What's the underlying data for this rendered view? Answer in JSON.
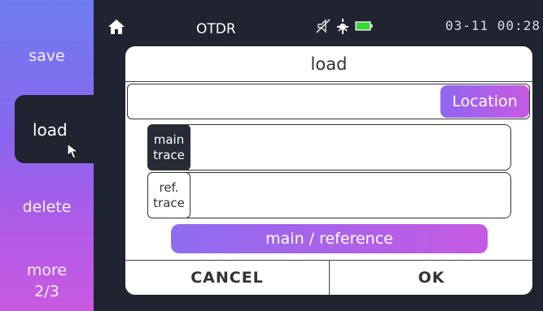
{
  "sidebar": {
    "items": [
      {
        "label": "save"
      },
      {
        "label": "load"
      },
      {
        "label": "delete"
      },
      {
        "label_line1": "more",
        "label_line2": "2/3"
      }
    ]
  },
  "statusbar": {
    "title": "OTDR",
    "datetime": "03-11 00:28",
    "icons": [
      "home-icon",
      "mute-icon",
      "sun-icon",
      "battery-icon"
    ]
  },
  "dialog": {
    "title": "load",
    "location_label": "Location",
    "main_trace": {
      "line1": "main",
      "line2": "trace"
    },
    "ref_trace": {
      "line1": "ref.",
      "line2": "trace"
    },
    "mode_label": "main / reference",
    "cancel_label": "CANCEL",
    "ok_label": "OK"
  },
  "colors": {
    "background": "#1f2430",
    "accent_gradient_start": "#8f67f0",
    "accent_gradient_end": "#c65ae2",
    "sidebar_top": "#6d7cf0",
    "battery": "#39d63a"
  }
}
